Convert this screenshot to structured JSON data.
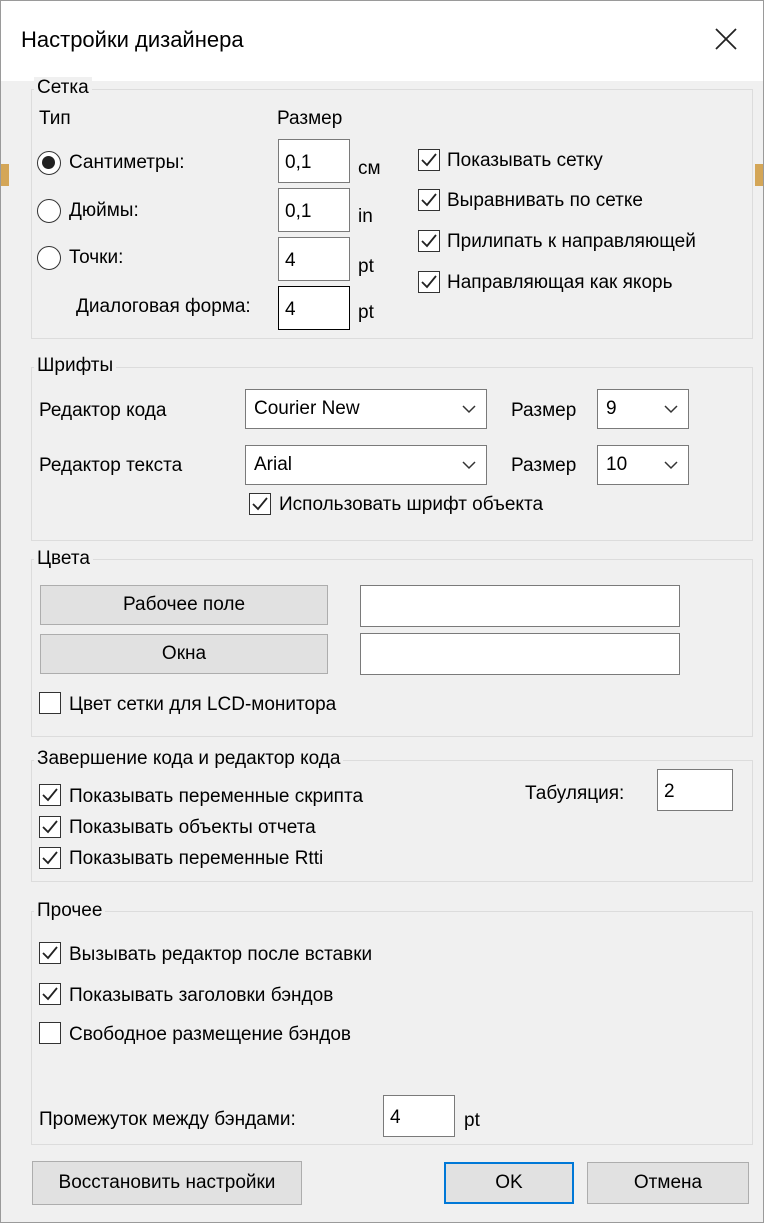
{
  "window": {
    "title": "Настройки дизайнера",
    "close_icon": "close-icon"
  },
  "grid": {
    "legend": "Сетка",
    "type_header": "Тип",
    "size_header": "Размер",
    "units": [
      {
        "label": "Сантиметры:",
        "value": "0,1",
        "unit": "см",
        "selected": true
      },
      {
        "label": "Дюймы:",
        "value": "0,1",
        "unit": "in",
        "selected": false
      },
      {
        "label": "Точки:",
        "value": "4",
        "unit": "pt",
        "selected": false
      }
    ],
    "dialog_form_label": "Диалоговая форма:",
    "dialog_form_value": "4",
    "dialog_form_unit": "pt",
    "options": [
      {
        "label": "Показывать сетку",
        "checked": true
      },
      {
        "label": "Выравнивать по сетке",
        "checked": true
      },
      {
        "label": "Прилипать к направляющей",
        "checked": true
      },
      {
        "label": "Направляющая как якорь",
        "checked": true
      }
    ]
  },
  "fonts": {
    "legend": "Шрифты",
    "code_editor_label": "Редактор кода",
    "code_editor_font": "Courier New",
    "code_size_label": "Размер",
    "code_size": "9",
    "text_editor_label": "Редактор текста",
    "text_editor_font": "Arial",
    "text_size_label": "Размер",
    "text_size": "10",
    "use_object_font_label": "Использовать шрифт объекта",
    "use_object_font_checked": true
  },
  "colors": {
    "legend": "Цвета",
    "workspace_button": "Рабочее поле",
    "workspace_color": "#ffffff",
    "windows_button": "Окна",
    "windows_color": "#ffffff",
    "lcd_label": "Цвет сетки для LCD-монитора",
    "lcd_checked": false
  },
  "code": {
    "legend": "Завершение кода и редактор кода",
    "options": [
      {
        "label": "Показывать переменные скрипта",
        "checked": true
      },
      {
        "label": "Показывать объекты отчета",
        "checked": true
      },
      {
        "label": "Показывать переменные Rtti",
        "checked": true
      }
    ],
    "tab_label": "Табуляция:",
    "tab_value": "2"
  },
  "other": {
    "legend": "Прочее",
    "options": [
      {
        "label": "Вызывать редактор после вставки",
        "checked": true
      },
      {
        "label": "Показывать заголовки бэндов",
        "checked": true
      },
      {
        "label": "Свободное размещение бэндов",
        "checked": false
      }
    ],
    "gap_label": "Промежуток между бэндами:",
    "gap_value": "4",
    "gap_unit": "pt"
  },
  "buttons": {
    "restore": "Восстановить настройки",
    "ok": "OK",
    "cancel": "Отмена"
  }
}
